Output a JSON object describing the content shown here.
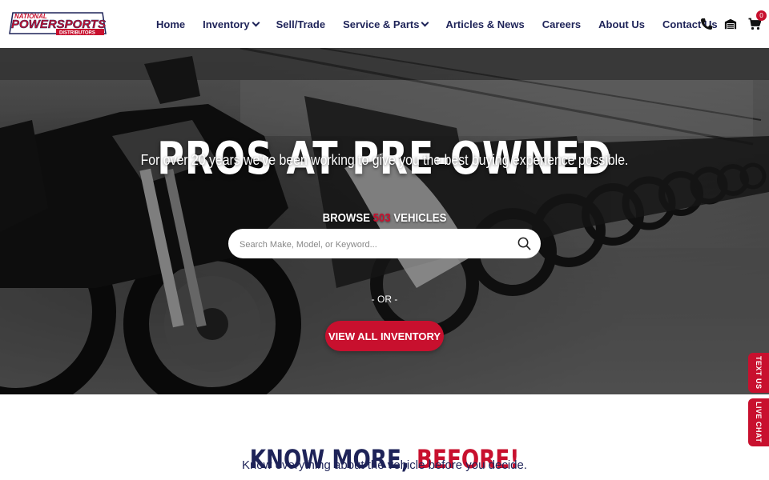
{
  "header": {
    "logo_top": "NATIONAL",
    "logo_main": "POWERSPORTS",
    "logo_bottom": "DISTRIBUTORS",
    "nav": [
      {
        "label": "Home",
        "dropdown": false
      },
      {
        "label": "Inventory",
        "dropdown": true
      },
      {
        "label": "Sell/Trade",
        "dropdown": false
      },
      {
        "label": "Service & Parts",
        "dropdown": true
      },
      {
        "label": "Articles & News",
        "dropdown": false
      },
      {
        "label": "Careers",
        "dropdown": false
      },
      {
        "label": "About Us",
        "dropdown": false
      },
      {
        "label": "Contact Us",
        "dropdown": false
      }
    ],
    "icons": [
      "phone-icon",
      "garage-icon",
      "cart-icon"
    ],
    "cart_count": "0"
  },
  "hero": {
    "title": "PROS AT PRE-OWNED",
    "subtitle": "For over 20 years we've been working to give you the best buying experience possible.",
    "browse_prefix": "BROWSE",
    "browse_count": "503",
    "browse_suffix": "VEHICLES",
    "search_placeholder": "Search Make, Model, or Keyword...",
    "or_text": "- OR -",
    "cta_label": "VIEW ALL INVENTORY"
  },
  "side_tabs": {
    "text_us": "TEXT US",
    "live_chat": "LIVE CHAT"
  },
  "know_more": {
    "title_part1": "KNOW MORE,",
    "title_part2": "BEFORE!",
    "subtitle": "Know everything about the vehicle before you decide."
  },
  "colors": {
    "brand_red": "#c8102e",
    "brand_navy": "#1e2358"
  }
}
